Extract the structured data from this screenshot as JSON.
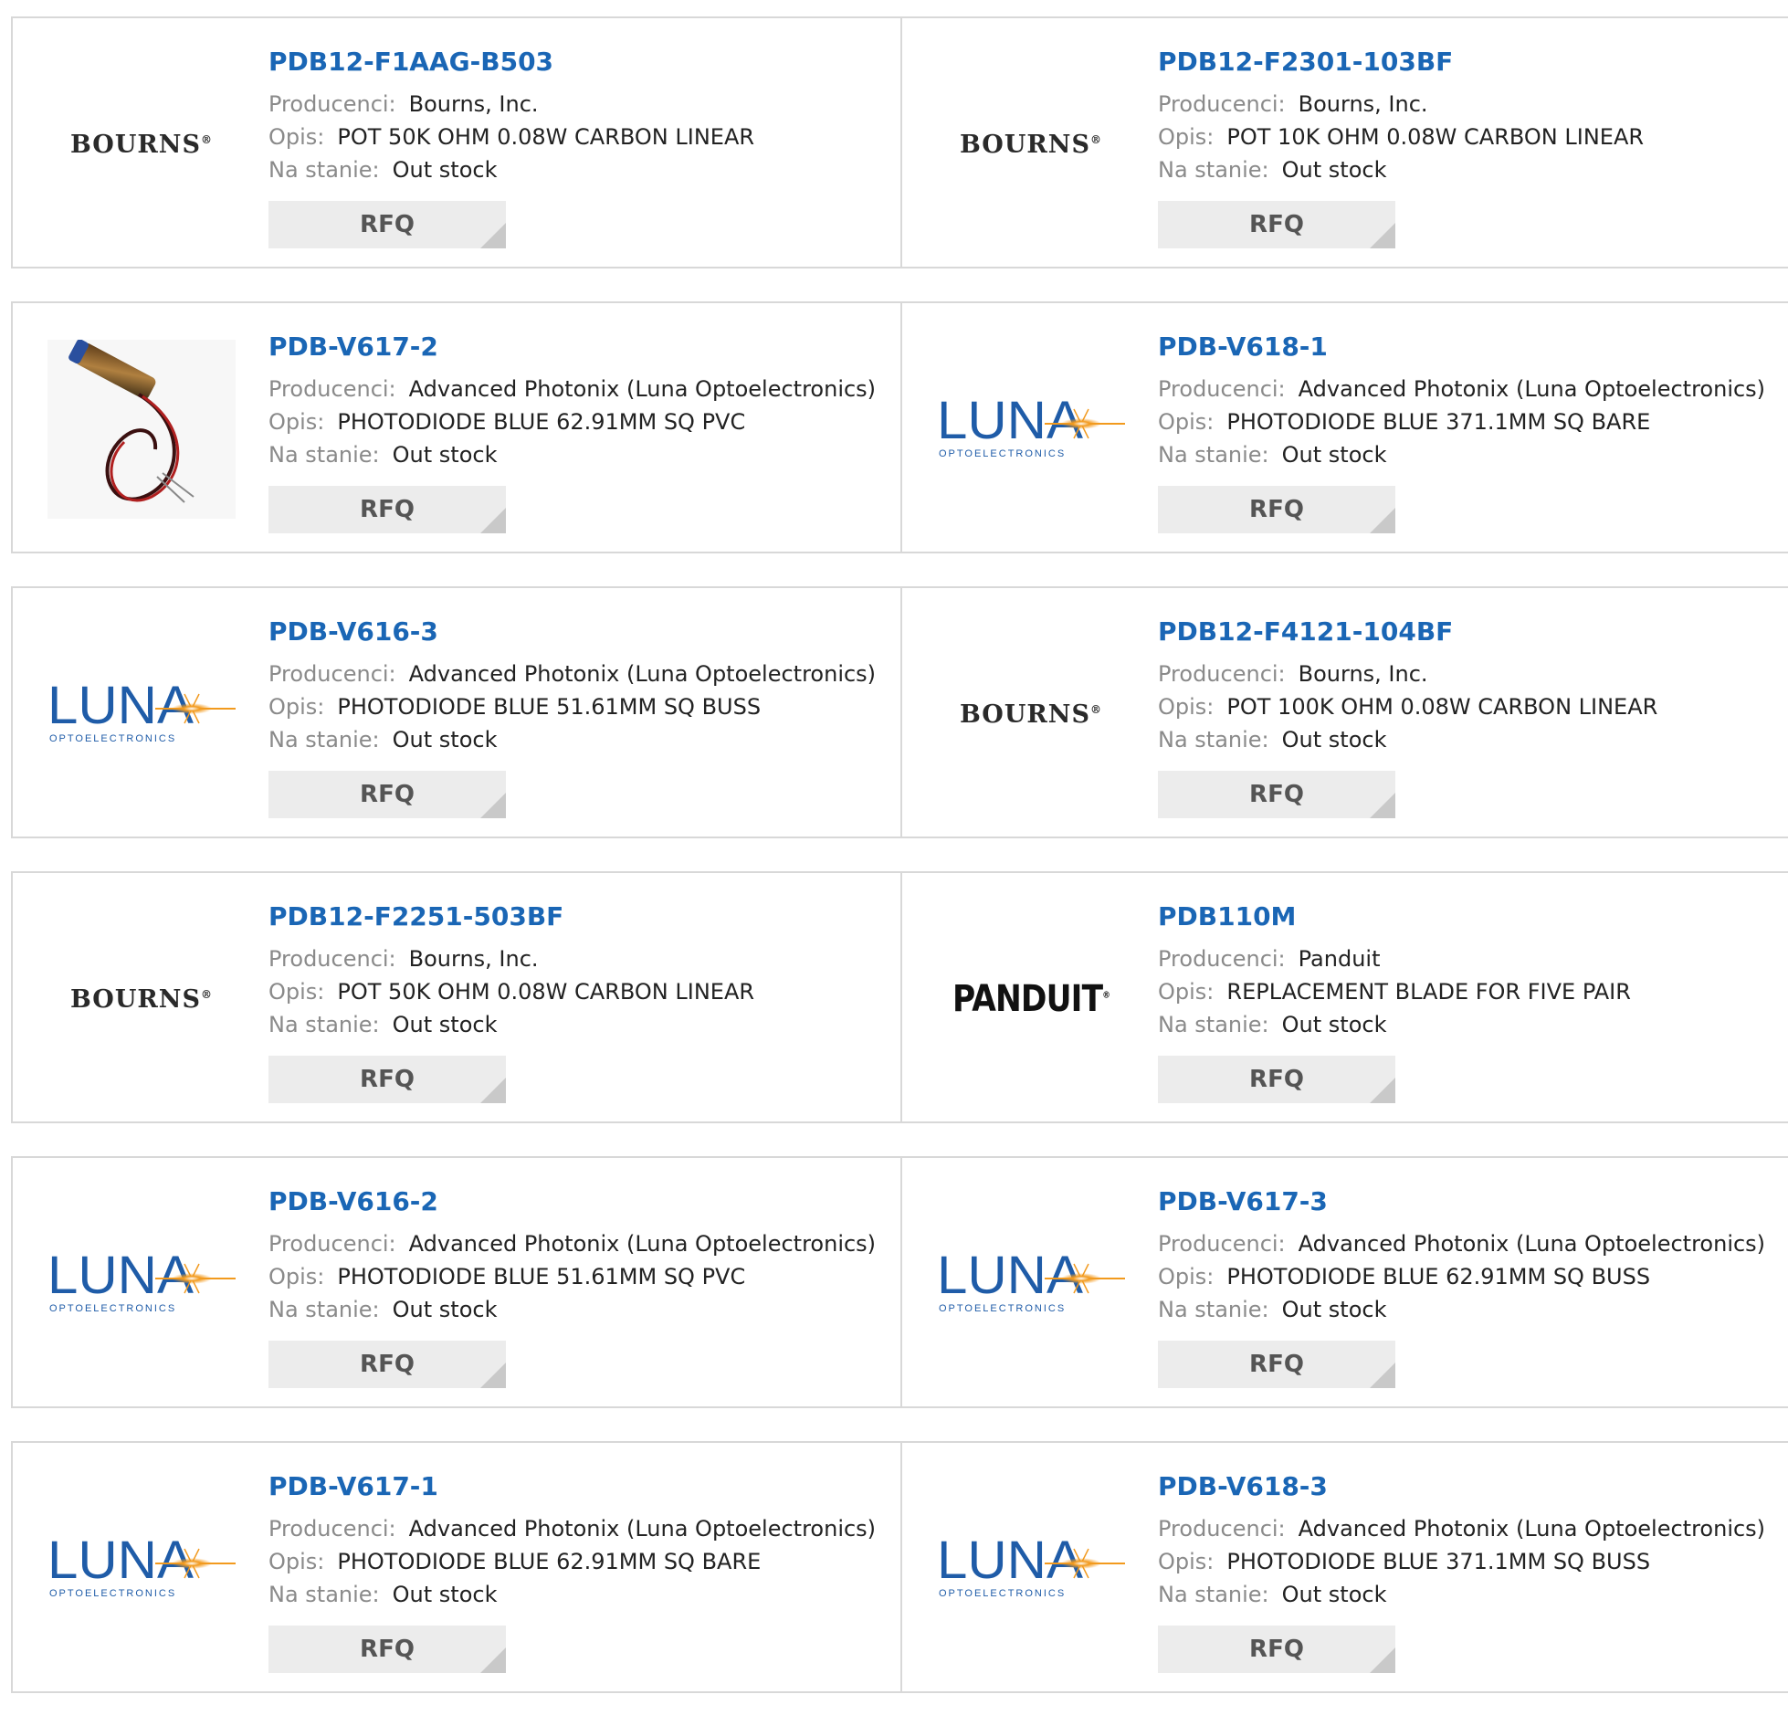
{
  "labels": {
    "manufacturer": "Producenci:",
    "description": "Opis:",
    "stock": "Na stanie:",
    "rfq": "RFQ"
  },
  "colors": {
    "part_link": "#1a66b5",
    "label_gray": "#8a8a8a",
    "button_bg": "#ececec",
    "border": "#d8d8d8",
    "luna_blue": "#1f5ca8",
    "luna_orange": "#f29a1e"
  },
  "products": [
    {
      "part": "PDB12-F1AAG-B503",
      "manufacturer": "Bourns, Inc.",
      "description": "POT 50K OHM 0.08W CARBON LINEAR",
      "stock": "Out stock",
      "logo": "bourns-logo"
    },
    {
      "part": "PDB12-F2301-103BF",
      "manufacturer": "Bourns, Inc.",
      "description": "POT 10K OHM 0.08W CARBON LINEAR",
      "stock": "Out stock",
      "logo": "bourns-logo"
    },
    {
      "part": "PDB-V617-2",
      "manufacturer": "Advanced Photonix (Luna Optoelectronics)",
      "description": "PHOTODIODE BLUE 62.91MM SQ PVC",
      "stock": "Out stock",
      "logo": "photodiode-image"
    },
    {
      "part": "PDB-V618-1",
      "manufacturer": "Advanced Photonix (Luna Optoelectronics)",
      "description": "PHOTODIODE BLUE 371.1MM SQ BARE",
      "stock": "Out stock",
      "logo": "luna-logo"
    },
    {
      "part": "PDB-V616-3",
      "manufacturer": "Advanced Photonix (Luna Optoelectronics)",
      "description": "PHOTODIODE BLUE 51.61MM SQ BUSS",
      "stock": "Out stock",
      "logo": "luna-logo"
    },
    {
      "part": "PDB12-F4121-104BF",
      "manufacturer": "Bourns, Inc.",
      "description": "POT 100K OHM 0.08W CARBON LINEAR",
      "stock": "Out stock",
      "logo": "bourns-logo"
    },
    {
      "part": "PDB12-F2251-503BF",
      "manufacturer": "Bourns, Inc.",
      "description": "POT 50K OHM 0.08W CARBON LINEAR",
      "stock": "Out stock",
      "logo": "bourns-logo"
    },
    {
      "part": "PDB110M",
      "manufacturer": "Panduit",
      "description": "REPLACEMENT BLADE FOR FIVE PAIR",
      "stock": "Out stock",
      "logo": "panduit-logo"
    },
    {
      "part": "PDB-V616-2",
      "manufacturer": "Advanced Photonix (Luna Optoelectronics)",
      "description": "PHOTODIODE BLUE 51.61MM SQ PVC",
      "stock": "Out stock",
      "logo": "luna-logo"
    },
    {
      "part": "PDB-V617-3",
      "manufacturer": "Advanced Photonix (Luna Optoelectronics)",
      "description": "PHOTODIODE BLUE 62.91MM SQ BUSS",
      "stock": "Out stock",
      "logo": "luna-logo"
    },
    {
      "part": "PDB-V617-1",
      "manufacturer": "Advanced Photonix (Luna Optoelectronics)",
      "description": "PHOTODIODE BLUE 62.91MM SQ BARE",
      "stock": "Out stock",
      "logo": "luna-logo"
    },
    {
      "part": "PDB-V618-3",
      "manufacturer": "Advanced Photonix (Luna Optoelectronics)",
      "description": "PHOTODIODE BLUE 371.1MM SQ BUSS",
      "stock": "Out stock",
      "logo": "luna-logo"
    }
  ],
  "logos": {
    "bourns": "BOURNS",
    "luna": "LUNA",
    "luna_sub": "OPTOELECTRONICS",
    "panduit": "PANDUIT"
  }
}
